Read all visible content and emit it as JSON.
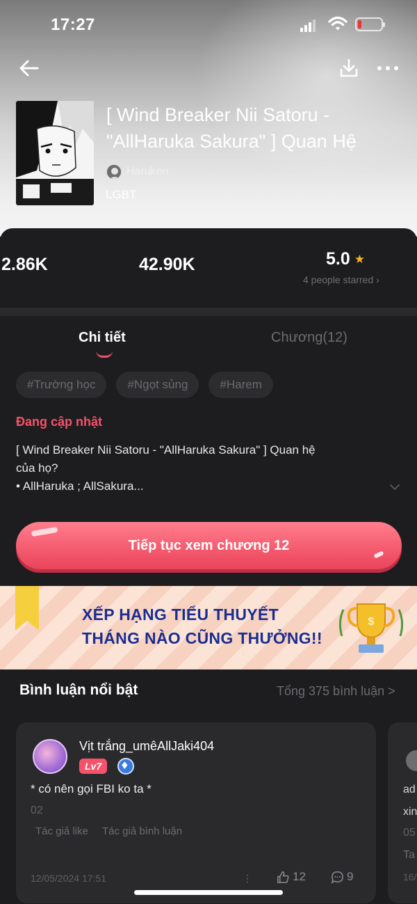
{
  "status_bar": {
    "time": "17:27"
  },
  "header": {
    "title": "[ Wind Breaker Nii Satoru - \"AllHaruka Sakura\" ] Quan Hệ",
    "author": "Haruken",
    "genre": "LGBT"
  },
  "stats": {
    "reads": "2.86K",
    "votes": "42.90K",
    "rating": "5.0",
    "starred": "4 people starred ›"
  },
  "tabs": {
    "details": "Chi tiết",
    "chapters": "Chương(12)"
  },
  "tags": [
    "#Trường học",
    "#Ngọt sủng",
    "#Harem"
  ],
  "status_label": "Đang cập nhật",
  "description": {
    "line1": "[ Wind Breaker Nii Satoru - \"AllHaruka Sakura\" ] Quan hệ",
    "line2": "của họ?",
    "line3": "• AllHaruka ; AllSakura..."
  },
  "continue_button": "Tiếp tục xem chương 12",
  "banner": {
    "line1": "XẾP HẠNG TIỂU THUYẾT",
    "line2": "THÁNG NÀO CŨNG THƯỞNG!!"
  },
  "comments": {
    "title": "Bình luận nổi bật",
    "total": "Tổng 375 bình luận >",
    "items": [
      {
        "user": "Vịt trắng_umêAllJaki404",
        "level": "Lv7",
        "text": "* có nên gọi FBI ko ta *",
        "number": "02",
        "chip1": "Tác giả like",
        "chip2": "Tác giả bình luận",
        "date": "12/05/2024 17:51",
        "more": "⋮",
        "likes": "12",
        "replies": "9"
      }
    ],
    "second_card_fragments": [
      "ad",
      "xin",
      "05",
      "Ta",
      "16/"
    ]
  },
  "colors": {
    "accent": "#f5526b",
    "background": "#1d1d1f",
    "card": "#2a2a2d",
    "star": "#f5b623"
  }
}
